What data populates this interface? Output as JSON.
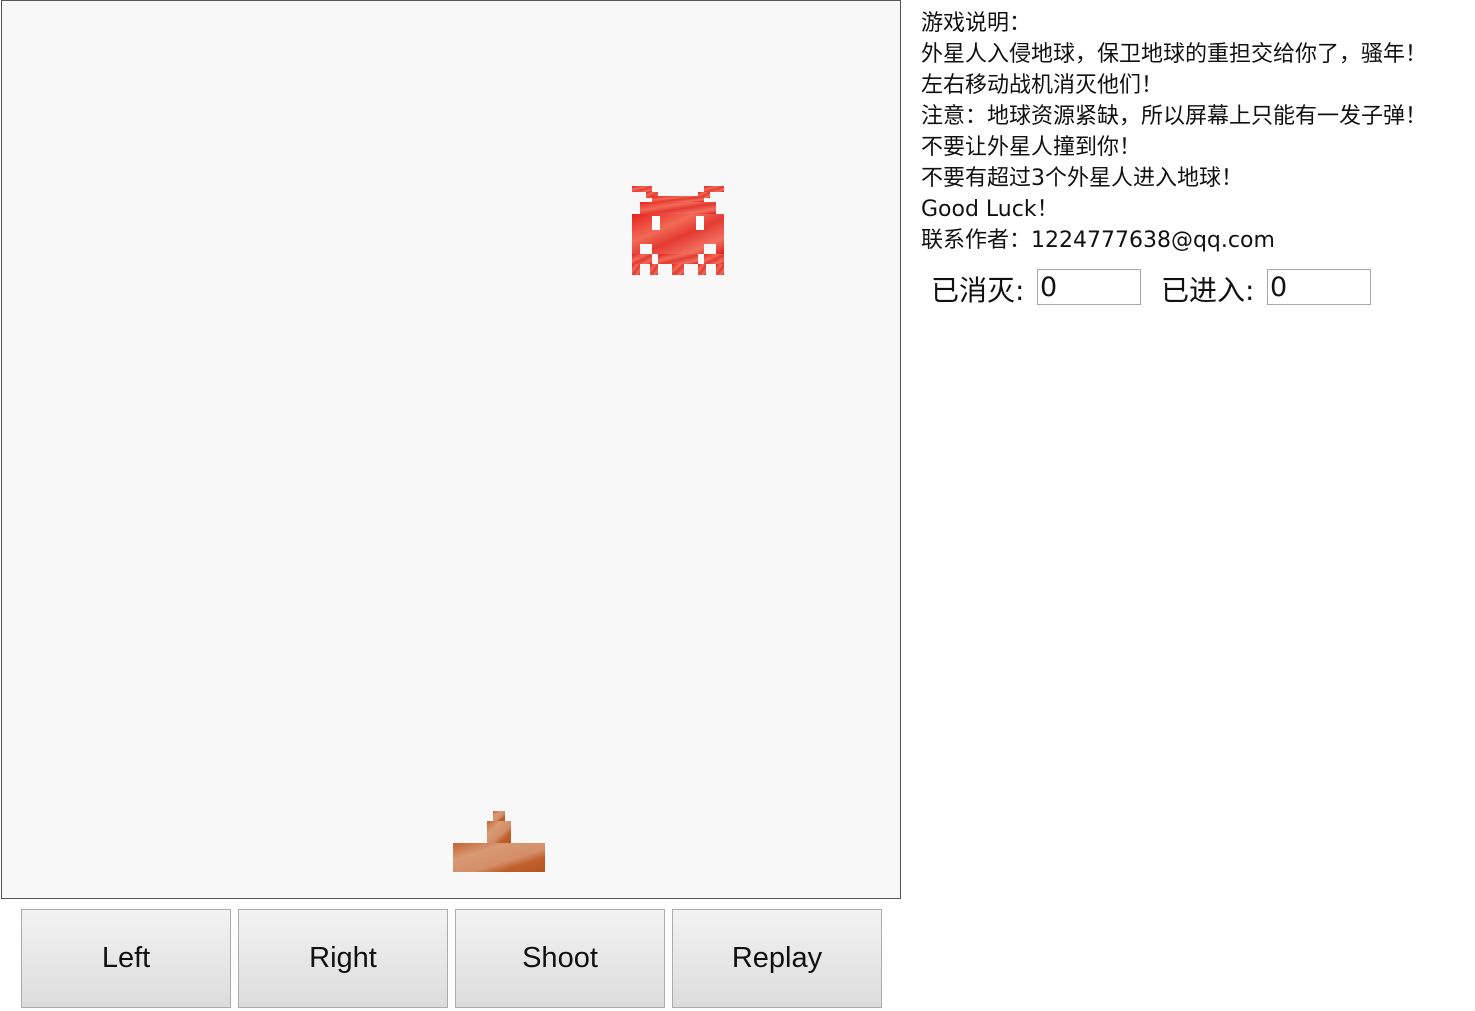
{
  "instructions": {
    "lines": [
      "游戏说明：",
      "外星人入侵地球，保卫地球的重担交给你了，骚年！",
      "左右移动战机消灭他们！",
      "注意：地球资源紧缺，所以屏幕上只能有一发子弹！",
      "不要让外星人撞到你！",
      "不要有超过3个外星人进入地球！",
      "Good Luck！",
      "联系作者：1224777638@qq.com"
    ]
  },
  "score": {
    "killed_label": "已消灭:",
    "killed_value": "0",
    "entered_label": "已进入:",
    "entered_value": "0"
  },
  "controls": {
    "left_label": "Left",
    "right_label": "Right",
    "shoot_label": "Shoot",
    "replay_label": "Replay"
  },
  "colors": {
    "alien": "#ee2a2a",
    "ship": "#c8693a",
    "game_background": "#f8f8f8"
  },
  "icons": {
    "alien": "pixel-space-invader",
    "ship": "pixel-fighter-ship"
  }
}
